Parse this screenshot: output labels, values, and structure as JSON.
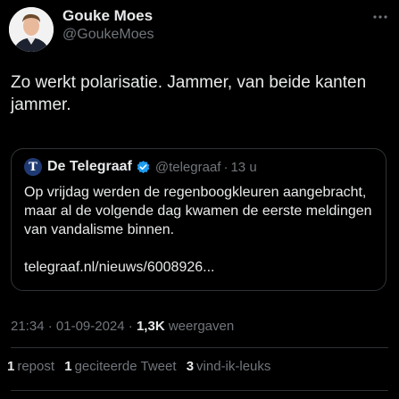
{
  "author": {
    "name": "Gouke Moes",
    "handle": "@GoukeMoes"
  },
  "more_icon": "more-horizontal-icon",
  "tweet": {
    "text": "Zo werkt polarisatie. Jammer, van beide kanten jammer."
  },
  "quoted": {
    "name": "De Telegraaf",
    "logo_letter": "T",
    "handle": "@telegraaf",
    "dot": "·",
    "time": "13 u",
    "verified_icon": "verified-badge-icon",
    "verified_color": "#1d9bf0",
    "text": "Op vrijdag werden de regenboogkleuren aangebracht, maar al de volgende dag kwamen de eerste meldingen van vandalisme binnen.",
    "link": "telegraaf.nl/nieuws/6008926..."
  },
  "meta": {
    "time": "21:34",
    "dot": "·",
    "date": "01-09-2024",
    "views": "1,3K",
    "views_label": "weergaven"
  },
  "stats": {
    "reposts_count": "1",
    "reposts_label": "repost",
    "quotes_count": "1",
    "quotes_label": "geciteerde Tweet",
    "likes_count": "3",
    "likes_label": "vind-ik-leuks"
  },
  "colors": {
    "background": "#000000",
    "text": "#e7e9ea",
    "muted": "#71767b",
    "border": "#2f3336"
  }
}
